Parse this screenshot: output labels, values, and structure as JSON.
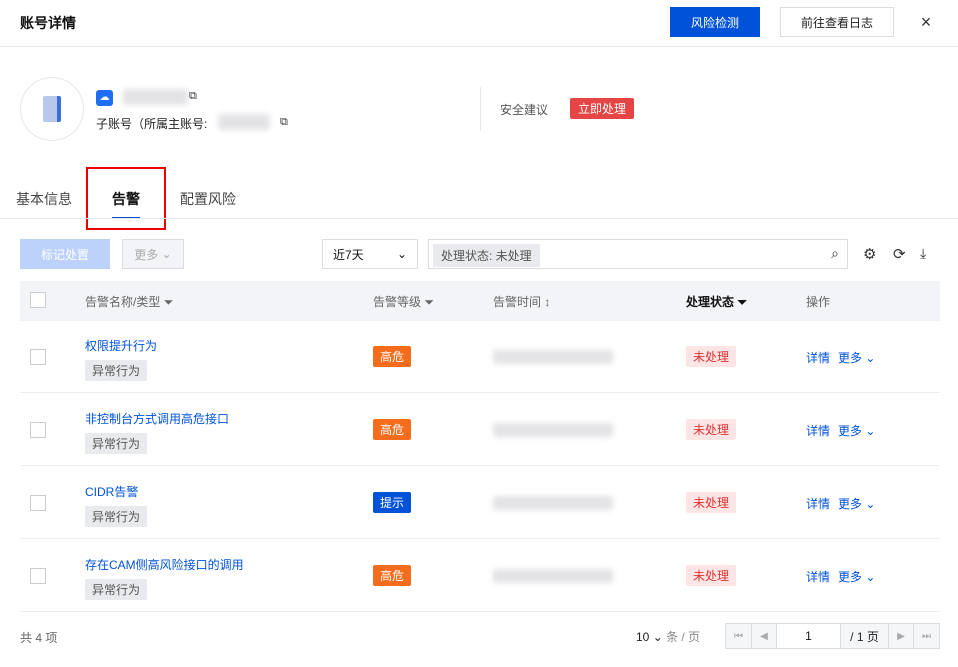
{
  "header": {
    "title": "账号详情",
    "risk_check": "风险检测",
    "view_logs": "前往查看日志",
    "close": "×"
  },
  "account": {
    "sub_label": "子账号（所属主账号:",
    "advice_label": "安全建议",
    "advice_action": "立即处理"
  },
  "tabs": [
    {
      "label": "基本信息"
    },
    {
      "label": "告警"
    },
    {
      "label": "配置风险"
    }
  ],
  "toolbar": {
    "mark": "标记处置",
    "more": "更多",
    "range": "近7天",
    "filter_tag": "处理状态: 未处理"
  },
  "table": {
    "headers": [
      "告警名称/类型",
      "告警等级",
      "告警时间",
      "处理状态",
      "操作"
    ],
    "rows": [
      {
        "name": "权限提升行为",
        "type": "异常行为",
        "level": "高危",
        "status": "未处理"
      },
      {
        "name": "非控制台方式调用高危接口",
        "type": "异常行为",
        "level": "高危",
        "status": "未处理"
      },
      {
        "name": "CIDR告警",
        "type": "异常行为",
        "level": "提示",
        "status": "未处理"
      },
      {
        "name": "存在CAM侧高风险接口的调用",
        "type": "异常行为",
        "level": "高危",
        "status": "未处理"
      }
    ],
    "detail": "详情",
    "more": "更多"
  },
  "footer": {
    "total": "共 4 项",
    "page_size": "10",
    "per_page": "条 / 页",
    "page": "1",
    "pages": "/ 1 页"
  },
  "colors": {
    "primary": "#0052d9",
    "danger": "#e54545",
    "high": "#f56c1d",
    "info": "#0052d9"
  }
}
